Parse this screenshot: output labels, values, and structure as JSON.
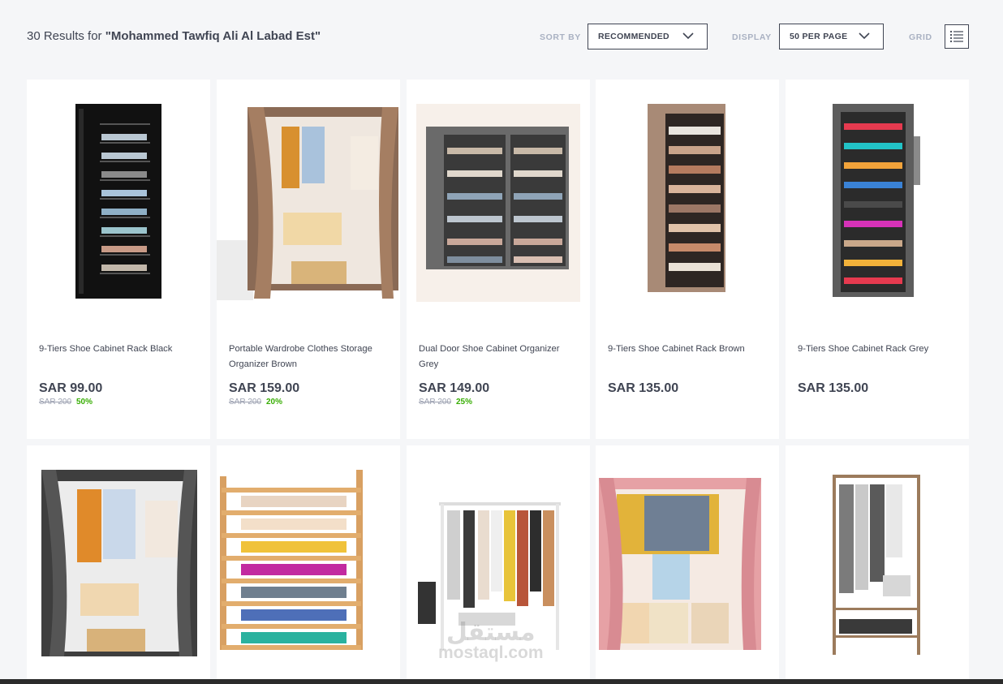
{
  "header": {
    "results_prefix": "30 Results for",
    "query": "\"Mohammed Tawfiq Ali Al Labad Est\"",
    "sort_label": "SORT BY",
    "sort_value": "RECOMMENDED",
    "display_label": "DISPLAY",
    "display_value": "50 PER PAGE",
    "grid_label": "GRID"
  },
  "products": [
    {
      "name": "9-Tiers Shoe Cabinet Rack Black",
      "price": "SAR 99.00",
      "old_price": "SAR 200",
      "discount": "50%",
      "icon": "shoe-cabinet-black"
    },
    {
      "name": "Portable Wardrobe Clothes Storage Organizer Brown",
      "price": "SAR 159.00",
      "old_price": "SAR 200",
      "discount": "20%",
      "icon": "wardrobe-brown"
    },
    {
      "name": "Dual Door Shoe Cabinet Organizer Grey",
      "price": "SAR 149.00",
      "old_price": "SAR 200",
      "discount": "25%",
      "icon": "dual-shoe-cabinet-grey"
    },
    {
      "name": "9-Tiers Shoe Cabinet Rack Brown",
      "price": "SAR 135.00",
      "old_price": "",
      "discount": "",
      "icon": "shoe-cabinet-brown"
    },
    {
      "name": "9-Tiers Shoe Cabinet Rack Grey",
      "price": "SAR 135.00",
      "old_price": "",
      "discount": "",
      "icon": "shoe-cabinet-grey"
    },
    {
      "name": "",
      "icon": "wardrobe-grey"
    },
    {
      "name": "",
      "icon": "bamboo-shoe-rack"
    },
    {
      "name": "",
      "icon": "clothes-rail-white"
    },
    {
      "name": "",
      "icon": "wardrobe-pink"
    },
    {
      "name": "",
      "icon": "clothes-rack-metal"
    }
  ],
  "watermark": {
    "arabic": "مستقل",
    "latin": "mostaql.com"
  },
  "colors": {
    "text": "#404553",
    "label": "#a9b1c2",
    "discount": "#38ae04",
    "background": "#f5f6f8"
  }
}
